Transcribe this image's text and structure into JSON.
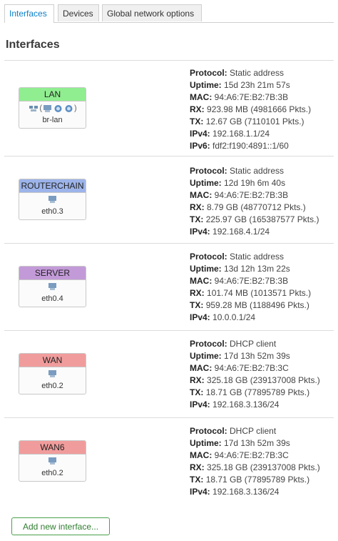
{
  "tabs": [
    {
      "label": "Interfaces",
      "active": true
    },
    {
      "label": "Devices",
      "active": false
    },
    {
      "label": "Global network options",
      "active": false
    }
  ],
  "page_title": "Interfaces",
  "labels": {
    "protocol": "Protocol:",
    "uptime": "Uptime:",
    "mac": "MAC:",
    "rx": "RX:",
    "tx": "TX:",
    "ipv4": "IPv4:",
    "ipv6": "IPv6:"
  },
  "interfaces": [
    {
      "name": "LAN",
      "color": "#90ee90",
      "device": "br-lan",
      "protocol": "Static address",
      "uptime": "15d 23h 21m 57s",
      "mac": "94:A6:7E:B2:7B:3B",
      "rx": "923.98 MB (4981666 Pkts.)",
      "tx": "12.67 GB (7110101 Pkts.)",
      "ipv4": "192.168.1.1/24",
      "ipv6": "fdf2:f190:4891::1/60"
    },
    {
      "name": "ROUTERCHAIN",
      "color": "#9db4ea",
      "device": "eth0.3",
      "protocol": "Static address",
      "uptime": "12d 19h 6m 40s",
      "mac": "94:A6:7E:B2:7B:3B",
      "rx": "8.79 GB (48770712 Pkts.)",
      "tx": "225.97 GB (165387577 Pkts.)",
      "ipv4": "192.168.4.1/24"
    },
    {
      "name": "SERVER",
      "color": "#c39ad8",
      "device": "eth0.4",
      "protocol": "Static address",
      "uptime": "13d 12h 13m 22s",
      "mac": "94:A6:7E:B2:7B:3B",
      "rx": "101.74 MB (1013571 Pkts.)",
      "tx": "959.28 MB (1188496 Pkts.)",
      "ipv4": "10.0.0.1/24"
    },
    {
      "name": "WAN",
      "color": "#f19c9c",
      "device": "eth0.2",
      "protocol": "DHCP client",
      "uptime": "17d 13h 52m 39s",
      "mac": "94:A6:7E:B2:7B:3C",
      "rx": "325.18 GB (239137008 Pkts.)",
      "tx": "18.71 GB (77895789 Pkts.)",
      "ipv4": "192.168.3.136/24"
    },
    {
      "name": "WAN6",
      "color": "#f19c9c",
      "device": "eth0.2",
      "protocol": "DHCP client",
      "uptime": "17d 13h 52m 39s",
      "mac": "94:A6:7E:B2:7B:3C",
      "rx": "325.18 GB (239137008 Pkts.)",
      "tx": "18.71 GB (77895789 Pkts.)",
      "ipv4": "192.168.3.136/24"
    }
  ],
  "lan_bridge_icons": [
    "(",
    ")"
  ],
  "add_button": "Add new interface..."
}
